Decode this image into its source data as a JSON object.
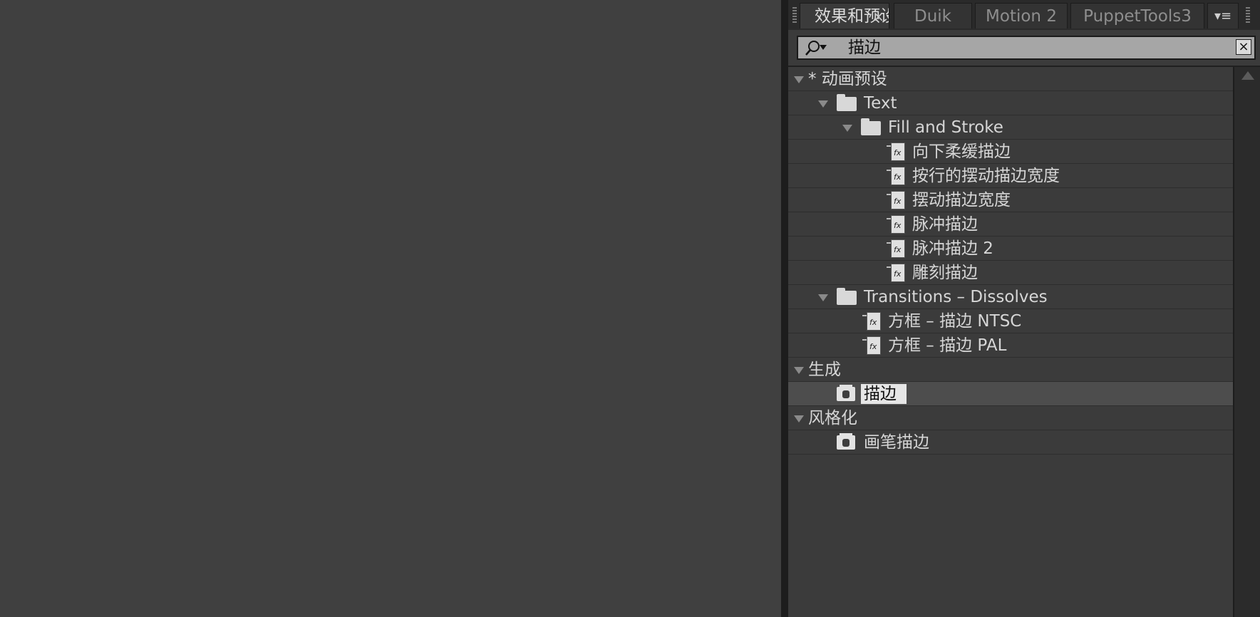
{
  "tabs": [
    {
      "label": "效果和预设",
      "close": "×",
      "active": true
    },
    {
      "label": "Duik",
      "active": false
    },
    {
      "label": "Motion 2",
      "active": false
    },
    {
      "label": "PuppetTools3",
      "active": false
    }
  ],
  "panel_menu_label": "▾≡",
  "search": {
    "value": "描边",
    "clear": "×"
  },
  "tree": {
    "animation_presets": "* 动画预设",
    "text_folder": "Text",
    "fill_stroke_folder": "Fill and Stroke",
    "fill_stroke_items": [
      "向下柔缓描边",
      "按行的摆动描边宽度",
      "摆动描边宽度",
      "脉冲描边",
      "脉冲描边 2",
      "雕刻描边"
    ],
    "transitions_folder": "Transitions – Dissolves",
    "transitions_items": [
      "方框 – 描边 NTSC",
      "方框 – 描边 PAL"
    ],
    "generate_category": "生成",
    "generate_items": [
      "描边"
    ],
    "stylize_category": "风格化",
    "stylize_items": [
      "画笔描边"
    ]
  }
}
